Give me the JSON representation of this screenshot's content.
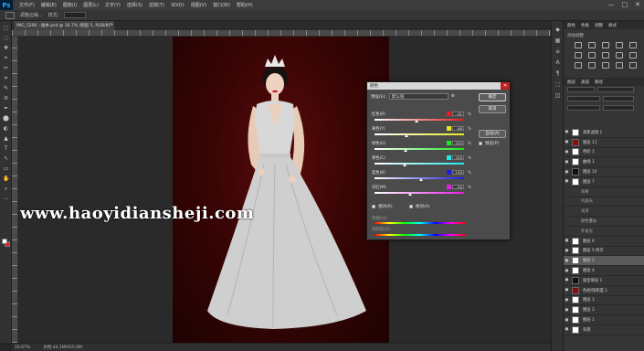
{
  "app": {
    "logo": "Ps",
    "menu": [
      "文件(F)",
      "编辑(E)",
      "图像(I)",
      "图层(L)",
      "文字(Y)",
      "选择(S)",
      "滤镜(T)",
      "3D(D)",
      "视图(V)",
      "窗口(W)",
      "帮助(H)"
    ],
    "window_controls": [
      "—",
      "□",
      "✕"
    ]
  },
  "options_bar": {
    "label_1": "调整边缘...",
    "label_2": "样式:",
    "value_2": "正常"
  },
  "document": {
    "tab_title": "IMG_5206 - 副本.psd @ 16.7% (图层 5, RGB/8) *",
    "tab_close": "×"
  },
  "watermark": "www.haoyidiansheji.com",
  "status": {
    "zoom": "16.67%",
    "doc_size": "文档:44.1M/415.0M"
  },
  "tools": [
    "⬚",
    "◌",
    "✥",
    "⌖",
    "✂",
    "⌗",
    "✎",
    "⊘",
    "✒",
    "⬤",
    "◐",
    "▲",
    "T",
    "↖",
    "▭",
    "✋",
    "⌕",
    "⋯"
  ],
  "right_icons": [
    "◆",
    "▦",
    "≡",
    "A",
    "¶",
    "⬚",
    "◫"
  ],
  "panel": {
    "tabs": [
      "颜色",
      "色板",
      "调整",
      "样式"
    ],
    "adjust_title": "添加调整",
    "layers_tabs": [
      "图层",
      "通道",
      "路径"
    ],
    "layers": [
      {
        "name": "高斯滤镜 1",
        "thumb": "white",
        "eye": "●"
      },
      {
        "name": "图层 11",
        "thumb": "red",
        "eye": "●"
      },
      {
        "name": "色阶 1",
        "thumb": "white",
        "eye": "●"
      },
      {
        "name": "曲线 1",
        "thumb": "white",
        "eye": "●"
      },
      {
        "name": "图层 10",
        "thumb": "dark",
        "eye": "●"
      },
      {
        "name": "图层 7",
        "thumb": "white",
        "eye": "●"
      },
      {
        "name": "效果",
        "thumb": "white",
        "eye": "",
        "sub": true
      },
      {
        "name": "内发光",
        "thumb": "",
        "eye": "",
        "sub": true
      },
      {
        "name": "光泽",
        "thumb": "",
        "eye": "",
        "sub": true
      },
      {
        "name": "颜色叠加",
        "thumb": "",
        "eye": "",
        "sub": true
      },
      {
        "name": "外发光",
        "thumb": "",
        "eye": "",
        "sub": true
      },
      {
        "name": "图层 6",
        "thumb": "white",
        "eye": "●"
      },
      {
        "name": "图层 5 拷贝",
        "thumb": "white",
        "eye": "●"
      },
      {
        "name": "图层 5",
        "thumb": "white",
        "eye": "●",
        "selected": true
      },
      {
        "name": "图层 4",
        "thumb": "white",
        "eye": "●"
      },
      {
        "name": "渐变填充 1",
        "thumb": "dark",
        "eye": "●"
      },
      {
        "name": "色相/饱和度 1",
        "thumb": "red",
        "eye": "●"
      },
      {
        "name": "图层 3",
        "thumb": "white",
        "eye": "●"
      },
      {
        "name": "图层 2",
        "thumb": "white",
        "eye": "●"
      },
      {
        "name": "图层 1",
        "thumb": "white",
        "eye": "●"
      },
      {
        "name": "背景",
        "thumb": "white",
        "eye": "●"
      }
    ]
  },
  "dialog": {
    "title": "颜色",
    "close": "✕",
    "preset_label": "预设(E):",
    "preset_value": "默认值",
    "ok": "确定",
    "cancel": "取消",
    "auto": "自动(A)",
    "preview_label": "预览(P)",
    "relative_label": "相对(R)",
    "absolute_label": "绝对(A)",
    "channels": [
      {
        "label": "红色(R)",
        "color": "#e81c1c",
        "value": "-41",
        "pos": 0.47
      },
      {
        "label": "黄色(Y)",
        "color": "#e8e81c",
        "value": "-68",
        "pos": 0.36
      },
      {
        "label": "绿色(G)",
        "color": "#1ce81c",
        "value": "-100",
        "pos": 0.35
      },
      {
        "label": "青色(C)",
        "color": "#1ce8e8",
        "value": "-100",
        "pos": 0.34
      },
      {
        "label": "蓝色(B)",
        "color": "#1c1ce8",
        "value": "+29",
        "pos": 0.52
      },
      {
        "label": "洋红(M)",
        "color": "#e81ce8",
        "value": "-50",
        "pos": 0.4
      }
    ],
    "hue_label": "色相(H):",
    "sat_label": "饱和度(S):",
    "pct": "%"
  }
}
